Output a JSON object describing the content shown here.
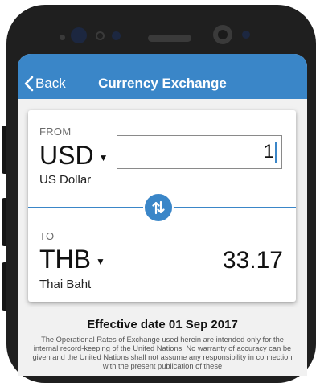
{
  "nav": {
    "back_label": "Back",
    "title": "Currency Exchange"
  },
  "from": {
    "label": "FROM",
    "code": "USD",
    "name": "US Dollar",
    "amount": "1"
  },
  "to": {
    "label": "TO",
    "code": "THB",
    "name": "Thai Baht",
    "amount": "33.17"
  },
  "effective_date": "Effective date 01 Sep 2017",
  "disclaimer": "The Operational Rates of Exchange used herein are intended only for the internal record-keeping of the United Nations. No warranty of accuracy can be given and the United Nations shall not assume any responsibility in connection with the present publication of these",
  "icons": {
    "back": "chevron-left-icon",
    "swap": "swap-arrows-icon",
    "dropdown": "caret-down-icon"
  },
  "colors": {
    "accent": "#3a86c8",
    "phone": "#1f1f1f",
    "screen_bg": "#f1f1f1"
  }
}
